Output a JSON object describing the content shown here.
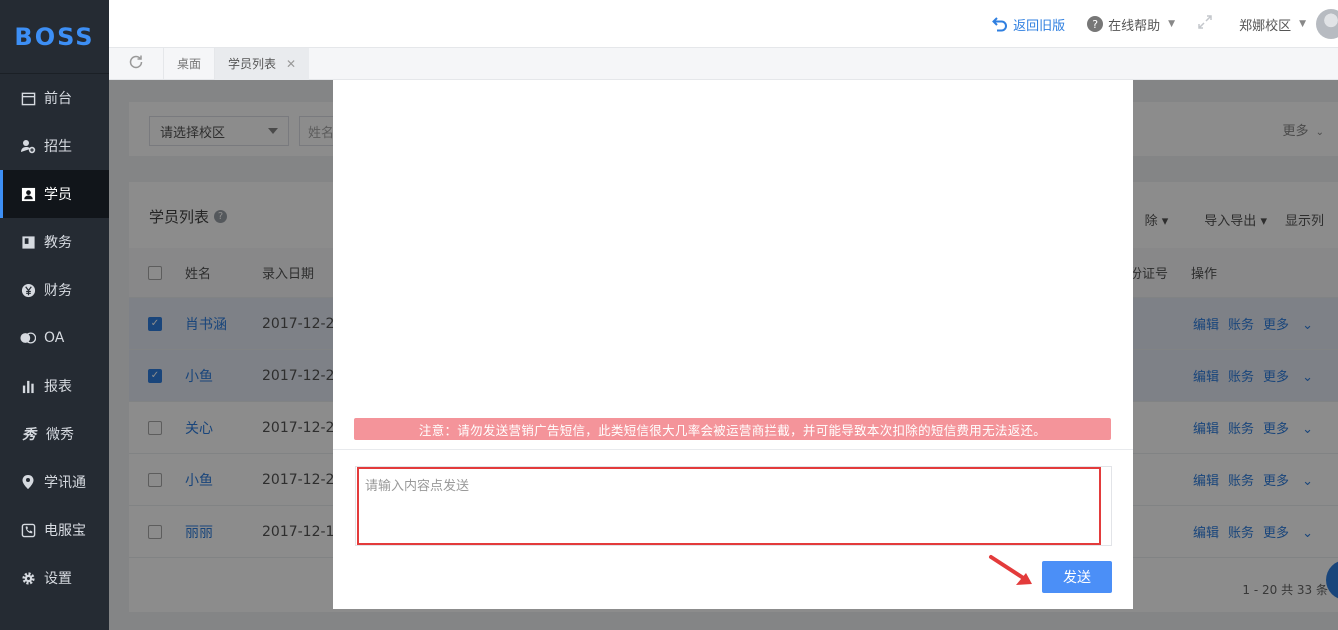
{
  "brand": {
    "logo": "BOSS",
    "accent": "#3d8ff5"
  },
  "sidebar": {
    "items": [
      {
        "label": "前台",
        "icon": "calendar-icon"
      },
      {
        "label": "招生",
        "icon": "user-add-icon"
      },
      {
        "label": "学员",
        "icon": "student-card-icon",
        "active": true
      },
      {
        "label": "教务",
        "icon": "book-icon"
      },
      {
        "label": "财务",
        "icon": "yen-icon"
      },
      {
        "label": "OA",
        "icon": "chat-bubble-icon"
      },
      {
        "label": "报表",
        "icon": "bar-chart-icon"
      },
      {
        "label": "微秀",
        "icon": "show-icon"
      },
      {
        "label": "学讯通",
        "icon": "location-pin-icon"
      },
      {
        "label": "电服宝",
        "icon": "phone-icon"
      },
      {
        "label": "设置",
        "icon": "gear-icon"
      }
    ]
  },
  "topbar": {
    "back_old": "返回旧版",
    "help": "在线帮助",
    "campus": "郑娜校区"
  },
  "tabs": [
    {
      "label": "桌面"
    },
    {
      "label": "学员列表",
      "active": true
    }
  ],
  "filter": {
    "campus_placeholder": "请选择校区",
    "name_placeholder": "姓名",
    "more": "更多"
  },
  "panel": {
    "title": "学员列表",
    "tools": [
      "除",
      "导入导出",
      "显示列"
    ],
    "headers": {
      "name": "姓名",
      "date": "录入日期",
      "id": "份证号",
      "ops": "操作"
    },
    "rows": [
      {
        "name": "肖书涵",
        "date": "2017-12-2",
        "checked": true
      },
      {
        "name": "小鱼",
        "date": "2017-12-2",
        "checked": true
      },
      {
        "name": "关心",
        "date": "2017-12-2",
        "checked": false
      },
      {
        "name": "小鱼",
        "date": "2017-12-2",
        "checked": false
      },
      {
        "name": "丽丽",
        "date": "2017-12-1",
        "checked": false
      }
    ],
    "ops": {
      "edit": "编辑",
      "account": "账务",
      "more": "更多"
    },
    "pager": "1 - 20  共 33 条"
  },
  "modal": {
    "warning": "注意：请勿发送营销广告短信，此类短信很大几率会被运营商拦截，并可能导致本次扣除的短信费用无法返还。",
    "input_placeholder": "请输入内容点发送",
    "send_label": "发送"
  }
}
